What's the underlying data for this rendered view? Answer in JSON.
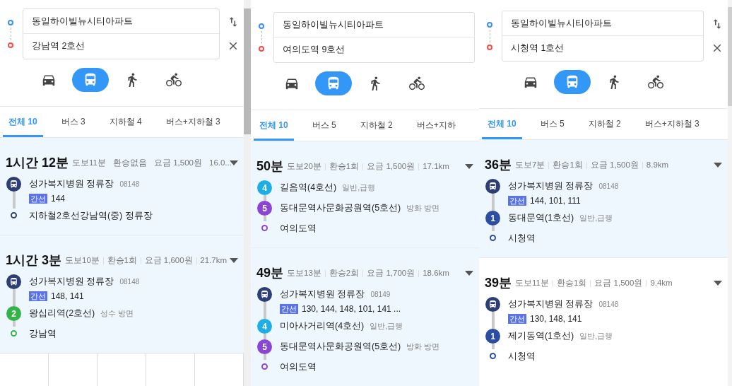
{
  "panels": [
    {
      "origin": "동일하이빌뉴시티아파트",
      "destination": "강남역 2호선",
      "modes": [
        {
          "kind": "car",
          "selected": false
        },
        {
          "kind": "bus",
          "selected": true
        },
        {
          "kind": "walk",
          "selected": false
        },
        {
          "kind": "bike",
          "selected": false
        }
      ],
      "tabs": [
        {
          "label": "전체 10",
          "selected": true
        },
        {
          "label": "버스 3",
          "selected": false
        },
        {
          "label": "지하철 4",
          "selected": false
        },
        {
          "label": "버스+지하철 3",
          "selected": false
        }
      ],
      "routes": [
        {
          "duration": "1시간 12분",
          "highlighted": true,
          "meta": [
            "도보11분",
            "환승없음",
            "요금 1,500원",
            "16.0..."
          ],
          "steps": [
            {
              "kind": "bus",
              "color": "#2c3e73",
              "name": "성가복지병원 정류장",
              "code": "08148",
              "tag": "간선",
              "lines": "144"
            },
            {
              "kind": "end",
              "color": "#2c3e73",
              "name": "지하철2호선강남역(중) 정류장"
            }
          ]
        },
        {
          "duration": "1시간 3분",
          "highlighted": true,
          "meta": [
            "도보10분",
            "환승1회",
            "요금 1,600원",
            "21.7km"
          ],
          "steps": [
            {
              "kind": "bus",
              "color": "#2c3e73",
              "name": "성가복지병원 정류장",
              "code": "08148",
              "tag": "간선",
              "lines": "148, 141"
            },
            {
              "kind": "subway",
              "color": "#35b34a",
              "badge": "2",
              "name": "왕십리역(2호선)",
              "note": "성수 방면"
            },
            {
              "kind": "end",
              "color": "#35b34a",
              "name": "강남역"
            }
          ]
        }
      ]
    },
    {
      "origin": "동일하이빌뉴시티아파트",
      "destination": "여의도역 9호선",
      "modes": [
        {
          "kind": "car",
          "selected": false
        },
        {
          "kind": "bus",
          "selected": true
        },
        {
          "kind": "walk",
          "selected": false
        },
        {
          "kind": "bike",
          "selected": false
        }
      ],
      "tabs": [
        {
          "label": "전체 10",
          "selected": true
        },
        {
          "label": "버스 5",
          "selected": false
        },
        {
          "label": "지하철 2",
          "selected": false
        },
        {
          "label": "버스+지하",
          "selected": false
        }
      ],
      "routes": [
        {
          "duration": "50분",
          "highlighted": true,
          "meta": [
            "도보20분",
            "환승1회",
            "요금 1,500원",
            "17.1km"
          ],
          "steps": [
            {
              "kind": "subway",
              "color": "#1eaee6",
              "badge": "4",
              "name": "길음역(4호선)",
              "note": "일반,급행"
            },
            {
              "kind": "subway",
              "color": "#8b45d6",
              "badge": "5",
              "name": "동대문역사문화공원역(5호선)",
              "note": "방화 방면"
            },
            {
              "kind": "end",
              "color": "#8b45d6",
              "name": "여의도역"
            }
          ]
        },
        {
          "duration": "49분",
          "highlighted": true,
          "meta": [
            "도보13분",
            "환승2회",
            "요금 1,700원",
            "18.6km"
          ],
          "steps": [
            {
              "kind": "bus",
              "color": "#2c3e73",
              "name": "성가복지병원 정류장",
              "code": "08149",
              "tag": "간선",
              "lines": "130, 144, 148, 101, 141 ..."
            },
            {
              "kind": "subway",
              "color": "#1eaee6",
              "badge": "4",
              "name": "미아사거리역(4호선)",
              "note": "일반,급행"
            },
            {
              "kind": "subway",
              "color": "#8b45d6",
              "badge": "5",
              "name": "동대문역사문화공원역(5호선)",
              "note": "방화 방면"
            },
            {
              "kind": "end",
              "color": "#8b45d6",
              "name": "여의도역"
            }
          ]
        }
      ]
    },
    {
      "origin": "동일하이빌뉴시티아파트",
      "destination": "시청역 1호선",
      "modes": [
        {
          "kind": "car",
          "selected": false
        },
        {
          "kind": "bus",
          "selected": true
        },
        {
          "kind": "walk",
          "selected": false
        },
        {
          "kind": "bike",
          "selected": false
        }
      ],
      "tabs": [
        {
          "label": "전체 10",
          "selected": true
        },
        {
          "label": "버스 5",
          "selected": false
        },
        {
          "label": "지하철 2",
          "selected": false
        },
        {
          "label": "버스+지하철 3",
          "selected": false
        }
      ],
      "routes": [
        {
          "duration": "36분",
          "highlighted": true,
          "meta": [
            "도보7분",
            "환승1회",
            "요금 1,500원",
            "8.9km"
          ],
          "steps": [
            {
              "kind": "bus",
              "color": "#2c3e73",
              "name": "성가복지병원 정류장",
              "code": "08148",
              "tag": "간선",
              "lines": "144, 101, 111"
            },
            {
              "kind": "subway",
              "color": "#2b4ea2",
              "badge": "1",
              "name": "동대문역(1호선)",
              "note": "일반,급행"
            },
            {
              "kind": "end",
              "color": "#2b4ea2",
              "name": "시청역"
            }
          ]
        },
        {
          "duration": "39분",
          "highlighted": false,
          "meta": [
            "도보11분",
            "환승1회",
            "요금 1,500원",
            "9.4km"
          ],
          "steps": [
            {
              "kind": "bus",
              "color": "#2c3e73",
              "name": "성가복지병원 정류장",
              "code": "08148",
              "tag": "간선",
              "lines": "130, 148, 141"
            },
            {
              "kind": "subway",
              "color": "#2b4ea2",
              "badge": "1",
              "name": "제기동역(1호선)",
              "note": "일반,급행"
            },
            {
              "kind": "end",
              "color": "#2b4ea2",
              "name": "시청역"
            }
          ]
        }
      ]
    }
  ]
}
